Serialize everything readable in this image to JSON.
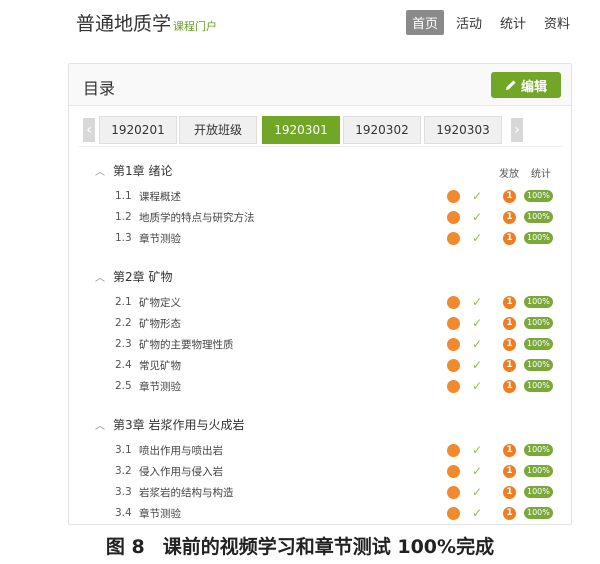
{
  "header": {
    "brand": "普通地质学",
    "brand_sub": "课程门户",
    "nav": [
      {
        "label": "首页",
        "active": true
      },
      {
        "label": "活动",
        "active": false
      },
      {
        "label": "统计",
        "active": false
      },
      {
        "label": "资料",
        "active": false
      }
    ]
  },
  "panel": {
    "title": "目录",
    "edit_label": "编辑",
    "tabs": [
      "1920201",
      "开放班级",
      "1920301",
      "1920302",
      "1920303"
    ],
    "active_tab": 2,
    "col_publish": "发放",
    "col_stats": "统计"
  },
  "chapters": [
    {
      "title": "第1章 绪论",
      "sections": [
        {
          "num": "1.1",
          "label": "课程概述",
          "published": "1",
          "percent": "100%"
        },
        {
          "num": "1.2",
          "label": "地质学的特点与研究方法",
          "published": "1",
          "percent": "100%"
        },
        {
          "num": "1.3",
          "label": "章节测验",
          "published": "1",
          "percent": "100%"
        }
      ]
    },
    {
      "title": "第2章 矿物",
      "sections": [
        {
          "num": "2.1",
          "label": "矿物定义",
          "published": "1",
          "percent": "100%"
        },
        {
          "num": "2.2",
          "label": "矿物形态",
          "published": "1",
          "percent": "100%"
        },
        {
          "num": "2.3",
          "label": "矿物的主要物理性质",
          "published": "1",
          "percent": "100%"
        },
        {
          "num": "2.4",
          "label": "常见矿物",
          "published": "1",
          "percent": "100%"
        },
        {
          "num": "2.5",
          "label": "章节测验",
          "published": "1",
          "percent": "100%"
        }
      ]
    },
    {
      "title": "第3章 岩浆作用与火成岩",
      "sections": [
        {
          "num": "3.1",
          "label": "喷出作用与喷出岩",
          "published": "1",
          "percent": "100%"
        },
        {
          "num": "3.2",
          "label": "侵入作用与侵入岩",
          "published": "1",
          "percent": "100%"
        },
        {
          "num": "3.3",
          "label": "岩浆岩的结构与构造",
          "published": "1",
          "percent": "100%"
        },
        {
          "num": "3.4",
          "label": "章节测验",
          "published": "1",
          "percent": "100%"
        }
      ]
    }
  ],
  "caption": {
    "figure": "图 8",
    "text": "课前的视频学习和章节测试 100%完成"
  },
  "colors": {
    "accent": "#72a626",
    "task_dot": "#f08a2c",
    "publish_badge": "#ef7d22",
    "percent_badge": "#7aa83a"
  }
}
